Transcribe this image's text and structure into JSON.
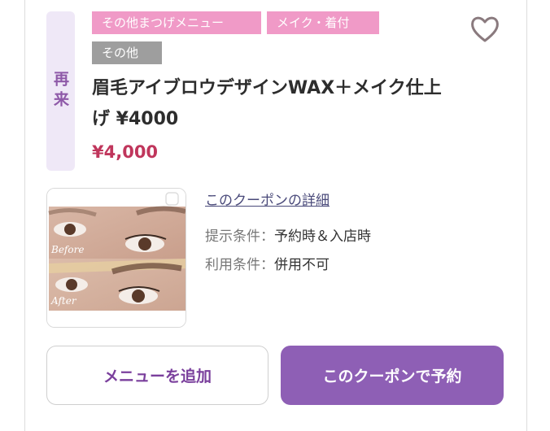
{
  "coupon": {
    "repeat_badge": "再来",
    "tags": [
      {
        "label": "その他まつげメニュー",
        "style": "pink"
      },
      {
        "label": "メイク・着付",
        "style": "pink"
      },
      {
        "label": "その他",
        "style": "gray"
      }
    ],
    "favorite_icon": "heart-outline-icon",
    "title": "眉毛アイブロウデザインWAX＋メイク仕上げ ¥4000",
    "price": "¥4,000",
    "image": {
      "before_label": "Before",
      "after_label": "After"
    },
    "detail_link": "このクーポンの詳細",
    "conditions": [
      {
        "label": "提示条件：",
        "value": "予約時＆入店時"
      },
      {
        "label": "利用条件：",
        "value": "併用不可"
      }
    ],
    "buttons": {
      "add_menu": "メニューを追加",
      "reserve": "このクーポンで予約"
    },
    "colors": {
      "accent": "#8e5fb5",
      "price": "#c0365c",
      "tag_pink": "#f09ac7",
      "tag_gray": "#9e9e9e",
      "repeat_bg": "#efe8f7"
    }
  }
}
